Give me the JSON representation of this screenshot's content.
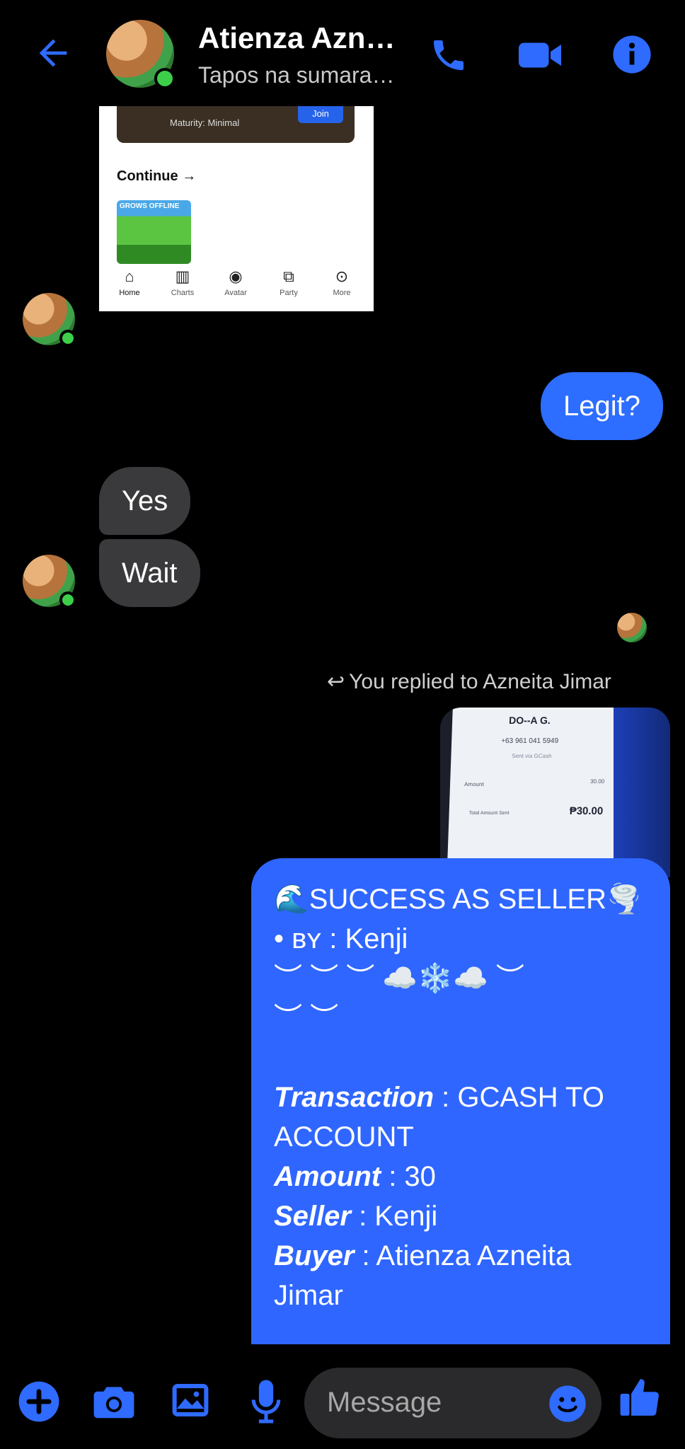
{
  "header": {
    "title": "Atienza Azn…",
    "subtitle": "Tapos na sumara…",
    "back_icon": "back-arrow-icon",
    "call_icon": "phone-icon",
    "video_icon": "video-camera-icon",
    "info_icon": "info-icon",
    "accent_color": "#2f6bff"
  },
  "shared_image": {
    "banner_text": "Maturity: Minimal",
    "join_label": "Join",
    "continue_label": "Continue →",
    "game_label": "GROWS OFFLINE",
    "nav": [
      "Home",
      "Charts",
      "Avatar",
      "Party",
      "More"
    ]
  },
  "messages": {
    "legit": "Legit?",
    "yes": "Yes",
    "wait": "Wait",
    "reply_note": "You replied to Azneita Jimar"
  },
  "receipt": {
    "name": "DO--A G.",
    "number": "+63 961 041 5949",
    "sent_via": "Sent via GCash",
    "amount_label": "Amount",
    "amount_value": "30.00",
    "total_label": "Total Amount Sent",
    "total_value": "₱30.00"
  },
  "big_message": {
    "title": "🌊SUCCESS AS SELLER🌪️",
    "by_prefix": "• ʙʏ : Kenji",
    "decor1": "︶ ︶ ︶ ☁️❄️☁️ ︶",
    "decor2": "︶ ︶",
    "transaction_label": "Transaction",
    "transaction_value": " : GCASH TO ACCOUNT",
    "amount_label": "Amount",
    "amount_value": " : 30",
    "seller_label": "Seller",
    "seller_value": " : Kenji",
    "buyer_label": "Buyer",
    "buyer_value": " : Atienza Azneita Jimar"
  },
  "composer": {
    "placeholder": "Message",
    "icons": [
      "plus-icon",
      "camera-icon",
      "gallery-icon",
      "mic-icon",
      "emoji-icon",
      "thumbs-up-icon"
    ]
  }
}
